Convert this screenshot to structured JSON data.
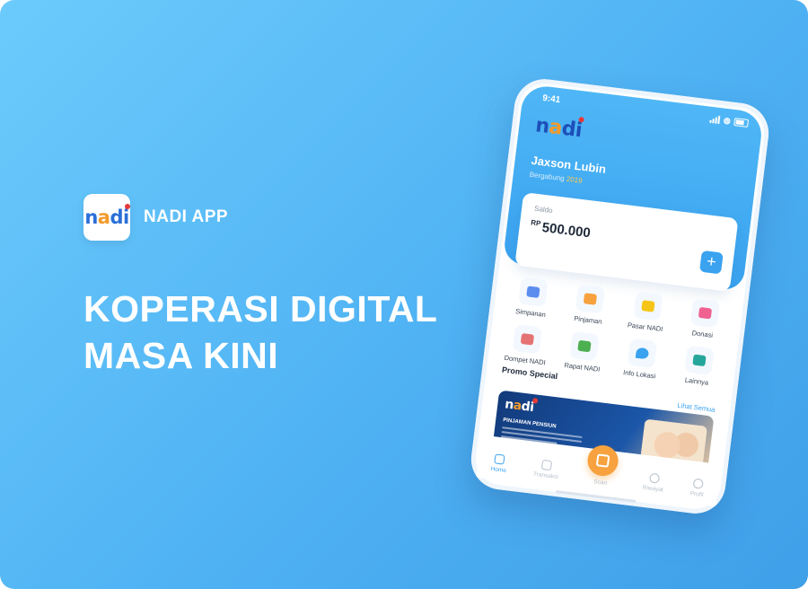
{
  "brand": {
    "logo_text": "nadi",
    "app_name": "NADI APP"
  },
  "headline": {
    "line1": "KOPERASI DIGITAL",
    "line2": "MASA KINI"
  },
  "phone": {
    "status_time": "9:41",
    "logo_text": "nadi",
    "user_name": "Jaxson Lubin",
    "joined_label": "Bergabung",
    "joined_year": "2019",
    "balance": {
      "label": "Saldo",
      "currency": "RP",
      "value": "500.000",
      "add_label": "+"
    },
    "menu": [
      {
        "label": "Simpanan",
        "icon": "savings-icon",
        "color": "#5b8def"
      },
      {
        "label": "Pinjaman",
        "icon": "loan-icon",
        "color": "#f7a23e"
      },
      {
        "label": "Pasar NADI",
        "icon": "market-icon",
        "color": "#f5c518"
      },
      {
        "label": "Donasi",
        "icon": "donation-icon",
        "color": "#f06292"
      },
      {
        "label": "Dompet NADI",
        "icon": "wallet-icon",
        "color": "#e57373"
      },
      {
        "label": "Rapat NADI",
        "icon": "meeting-icon",
        "color": "#4caf50"
      },
      {
        "label": "Info Lokasi",
        "icon": "location-icon",
        "color": "#3aa2ef"
      },
      {
        "label": "Lainnya",
        "icon": "grid-icon",
        "color": "#26a69a"
      }
    ],
    "promo": {
      "title": "Promo Special",
      "see_all": "Lihat Semua",
      "card_logo": "nadi",
      "card_headline": "PINJAMAN PENSIUN"
    },
    "tabs": [
      {
        "label": "Home",
        "active": true
      },
      {
        "label": "Transaksi",
        "active": false
      },
      {
        "label": "Scan",
        "active": false
      },
      {
        "label": "Riwayat",
        "active": false
      },
      {
        "label": "Profil",
        "active": false
      }
    ]
  }
}
